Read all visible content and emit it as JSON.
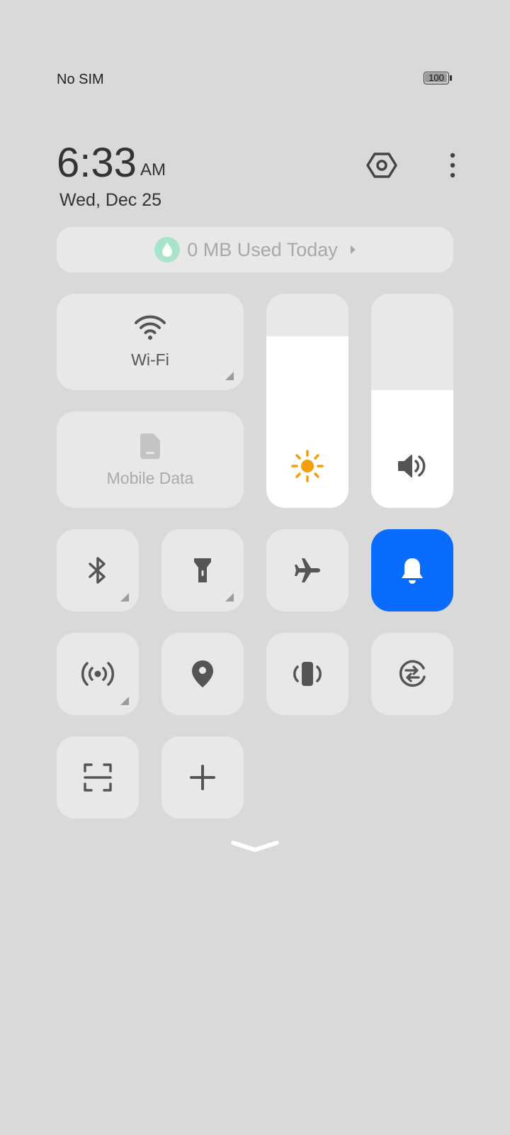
{
  "status_bar": {
    "carrier": "No SIM",
    "battery_level": "100"
  },
  "header": {
    "time": "6:33",
    "ampm": "AM",
    "date": "Wed, Dec 25"
  },
  "data_usage": {
    "label": "0 MB Used Today"
  },
  "tiles": {
    "wifi": {
      "label": "Wi-Fi",
      "active": true
    },
    "mobile_data": {
      "label": "Mobile Data",
      "active": false
    }
  },
  "sliders": {
    "brightness": {
      "level": 0.8,
      "icon": "sun-icon",
      "icon_color": "#f59d0c"
    },
    "volume": {
      "level": 0.55,
      "icon": "speaker-icon"
    }
  },
  "quick_tiles": [
    {
      "name": "bluetooth",
      "icon": "bluetooth-icon"
    },
    {
      "name": "flashlight",
      "icon": "flashlight-icon"
    },
    {
      "name": "airplane-mode",
      "icon": "airplane-icon"
    },
    {
      "name": "ring-mode",
      "icon": "bell-icon",
      "active_color": "#0a6cff"
    },
    {
      "name": "hotspot",
      "icon": "hotspot-icon"
    },
    {
      "name": "location",
      "icon": "location-pin-icon"
    },
    {
      "name": "vibrate",
      "icon": "vibrate-icon"
    },
    {
      "name": "data-saver",
      "icon": "swap-circle-icon"
    },
    {
      "name": "screenshot",
      "icon": "scan-icon"
    },
    {
      "name": "edit-tiles",
      "icon": "plus-icon"
    }
  ],
  "colors": {
    "background": "#d9d9d9",
    "tile": "#e8e8e8",
    "accent": "#0a6cff",
    "icon": "#5a5a5a"
  }
}
